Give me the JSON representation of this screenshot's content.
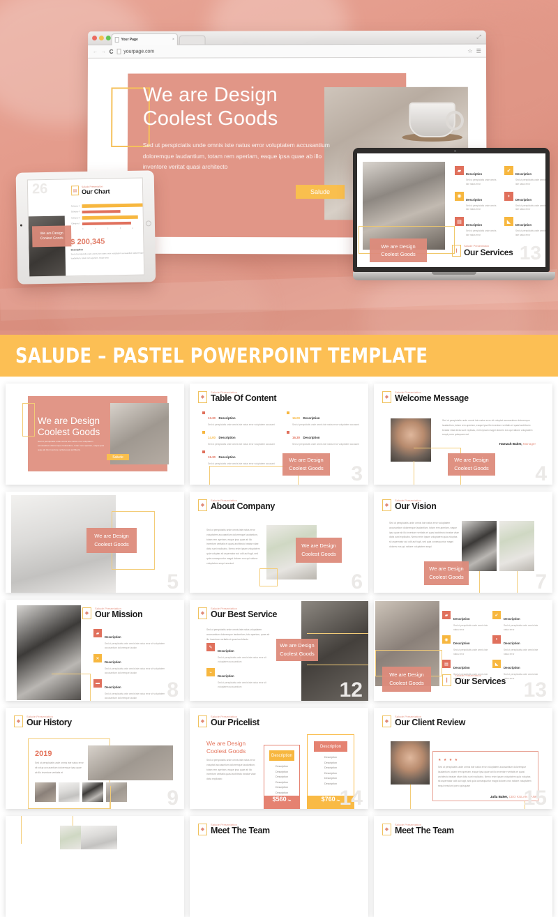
{
  "hero": {
    "browser": {
      "tab_title": "Your Page",
      "tab_close": "×",
      "url": "yourpage.com",
      "back_icon": "←",
      "forward_icon": "→",
      "reload_icon": "C",
      "star_icon": "☆",
      "menu_icon": "☰",
      "expand_icon": "⤢"
    },
    "slide": {
      "headline_line1": "We are Design",
      "headline_line2": "Coolest Goods",
      "body": "Sed ut perspiciatis unde omnis iste natus error voluptatem accusantium doloremque laudantium, totam rem aperiam, eaque ipsa quae ab illo inventore veritat quasi architecto",
      "button": "Salude"
    },
    "tablet": {
      "number": "26",
      "eyebrow": "Salude Presentation",
      "title": "Our Chart",
      "icon": "chart-icon",
      "badge_line1": "We are Design",
      "badge_line2": "Coolest Goods",
      "money": "$ 200,345",
      "desc_title": "Description",
      "desc_body": "Sed ut perspiciatis unde omnis iste natus error voluptatem accusantium doloremque laudantium, totam rem aperiam, eaque ipsa",
      "chart": {
        "categories": [
          "Category 4",
          "Category 3",
          "Category 2",
          "Category 1"
        ],
        "values": [
          4.5,
          2.8,
          4.1,
          3.6
        ],
        "colors": [
          "#f7b73f",
          "#e0705c",
          "#f7b73f",
          "#e0705c"
        ],
        "axis_ticks": [
          "0",
          "1",
          "2",
          "3",
          "4",
          "5"
        ]
      }
    },
    "laptop": {
      "number": "13",
      "eyebrow": "Salude Presentation",
      "title": "Our Services",
      "icon": "bookmark-icon",
      "badge_line1": "We are Design",
      "badge_line2": "Coolest Goods",
      "items": [
        {
          "icon": "image-icon",
          "glyph": "▰",
          "color": "#e0705c",
          "title": "Description",
          "body": "Sed ut perspiciatis unde omnis iste natus error"
        },
        {
          "icon": "check-icon",
          "glyph": "✔",
          "color": "#f7b73f",
          "title": "Description",
          "body": "Sed ut perspiciatis unde omnis iste natus error"
        },
        {
          "icon": "camera-icon",
          "glyph": "◉",
          "color": "#f7b73f",
          "title": "Description",
          "body": "Sed ut perspiciatis unde omnis iste natus error"
        },
        {
          "icon": "chat-icon",
          "glyph": "◗",
          "color": "#e0705c",
          "title": "Description",
          "body": "Sed ut perspiciatis unde omnis iste natus error"
        },
        {
          "icon": "database-icon",
          "glyph": "▤",
          "color": "#e0705c",
          "title": "Description",
          "body": "Sed ut perspiciatis unde omnis iste natus error"
        },
        {
          "icon": "tag-icon",
          "glyph": "◣",
          "color": "#f7b73f",
          "title": "Description",
          "body": "Sed ut perspiciatis unde omnis iste natus error"
        }
      ]
    }
  },
  "banner": {
    "title": "SALUDE – PASTEL POWERPOINT TEMPLATE"
  },
  "common": {
    "eyebrow": "Salude Presentation",
    "badge_line1": "We are Design",
    "badge_line2": "Coolest Goods",
    "description": "Description",
    "lorem_short": "Sed ut perspiciatis unde omnis iste natus error sit voluptatem accusantium doloremque laudan",
    "lorem_mid": "Sed ut perspiciatis unde omnis iste natus error voluptatem accusantium doloremque laudantium, totam rem aperiam, eaque ipsa quae ab illo inventore veritatis et quasi architecto beatae vitae dicta sunt explicabo.",
    "lorem_long": "Sed ut perspiciatis unde omnis iste natus error sit voluptatem accusantium doloremque laudantium, totam rem aperiam, eaque ipsa quae ab illo inventore veritatis et quasi architecto beatae vitae dicta sunt explicabo. Nemo enim ipsam voluptatem quia voluptas sit aspernatur aut odit aut fugit, sed quia consequuntur magni dolores eos qui ratione voluptatem sequi nesciunt"
  },
  "slides": [
    {
      "id": "cover",
      "name": "cover-slide",
      "number": "",
      "title": "",
      "headline_line1": "We are Design",
      "headline_line2": "Coolest Goods",
      "body": "Sed ut perspiciatis unde omnis iste natus error voluptatem accusantium doloremque laudantium, totam rem aperiam, eaque ipsa quae ab illo inventore veritat quasi architecto",
      "button": "Salude"
    },
    {
      "id": "toc",
      "name": "table-of-content-slide",
      "number": "3",
      "eyebrow": "Salude Presentation",
      "title": "Table Of Content",
      "icon": "pen-icon",
      "items": [
        {
          "time": "13.30",
          "color": "#e0705c",
          "title": "Description",
          "body": "Sed ut perspiciatis unde omnis iste natus error voluptatem accusant"
        },
        {
          "time": "16.00",
          "color": "#f7b73f",
          "title": "Description",
          "body": "Sed ut perspiciatis unde omnis iste natus error voluptatem accusant"
        },
        {
          "time": "14.00",
          "color": "#f7b73f",
          "title": "Description",
          "body": "Sed ut perspiciatis unde omnis iste natus error voluptatem accusant"
        },
        {
          "time": "16.30",
          "color": "#e0705c",
          "title": "Description",
          "body": "Sed ut perspiciatis unde omnis iste natus error voluptatem accusant"
        },
        {
          "time": "15.30",
          "color": "#e0705c",
          "title": "Description",
          "body": "Sed ut perspiciatis unde omnis iste natus error voluptatem accusant"
        }
      ]
    },
    {
      "id": "welcome",
      "name": "welcome-message-slide",
      "number": "4",
      "eyebrow": "Salude Presentation",
      "title": "Welcome Message",
      "icon": "rss-icon",
      "body": "Sed ut perspiciatis unde omnis iste natus error sit voluptat accusantium doloremque laudantium, totam rem aperiam, eaque ipsa illo inventore veritatis et quasi architecto beatae vitae dicta sunt explicau, enim ipsam magni dolores eos qui ratione voluptatem sequi porro quisquam est",
      "author_name": "Hamzah Baker,",
      "author_role": "Manager"
    },
    {
      "id": "office",
      "name": "office-photo-slide",
      "number": "5",
      "title": ""
    },
    {
      "id": "about",
      "name": "about-company-slide",
      "number": "6",
      "eyebrow": "Salude Presentation",
      "title": "About Company",
      "icon": "book-icon",
      "body": "Sed ut perspiciatis unde omnis iste natus error voluptatem accusantium doloremque laudantium, totam rem aperiam, eaque ipsa quae ab illo inventore veritatis et quasi architecto beatae vitae dicta sunt explicabo. Nemo enim ipsam voluptatem quia voluptas sit aspernatur aut odit aut fugit, sed quia consequuntur magni dolores eos qui ratione voluptatem sequi nesciunt"
    },
    {
      "id": "vision",
      "name": "our-vision-slide",
      "number": "7",
      "eyebrow": "Salude Presentation",
      "title": "Our Vision",
      "icon": "person-icon",
      "body": "Sed ut perspiciatis unde omnis iste natus error voluptatem accusantium doloremque laudantium, totam rem aperiam, eaque ipsa quae ab illo inventore veritatis et quasi architecto beatae vitae dicta sunt explicabo. Nemo enim ipsam voluptatem quia voluptas sit aspernatur aut odit aut fugit, sed quia consequuntur magni dolores eos qui ratione voluptatem sequi"
    },
    {
      "id": "mission",
      "name": "our-mission-slide",
      "number": "8",
      "eyebrow": "Salude Presentation",
      "title": "Our Mission",
      "icon": "rocket-icon",
      "items": [
        {
          "icon": "folder-icon",
          "glyph": "▰",
          "color": "#e0705c",
          "title": "Description",
          "body": "Sed ut perspiciatis unde omnis iste natus error sit voluptatem accusantium doloremque laudan"
        },
        {
          "icon": "tools-icon",
          "glyph": "✕",
          "color": "#f7b73f",
          "title": "Description",
          "body": "Sed ut perspiciatis unde omnis iste natus error sit voluptatem accusantium doloremque laudan"
        },
        {
          "icon": "briefcase-icon",
          "glyph": "▬",
          "color": "#e0705c",
          "title": "Description",
          "body": "Sed ut perspiciatis unde omnis iste natus error sit voluptatem accusantium doloremque laudan"
        }
      ]
    },
    {
      "id": "best-service",
      "name": "our-best-service-slide",
      "number": "12",
      "eyebrow": "Salude Presentation",
      "title": "Our Best Service",
      "icon": "pen-icon",
      "body": "Sed ut perspiciatis unde omnis iste natus voluptatem accusantium doloremque laudantium, tota aperiam, quae ab illo inventore veritatis et quasi architecto",
      "items": [
        {
          "icon": "pencil-icon",
          "glyph": "✎",
          "color": "#e0705c",
          "title": "Description",
          "body": "Sed ut perspiciatis unde omnis iste natus error sit voluptatem accusantium"
        },
        {
          "icon": "brush-icon",
          "glyph": "⌁",
          "color": "#f7b73f",
          "title": "Description",
          "body": "Sed ut perspiciatis unde omnis iste natus error sit voluptatem accusantium"
        }
      ]
    },
    {
      "id": "services",
      "name": "our-services-slide",
      "number": "13",
      "eyebrow": "Salude Presentation",
      "title": "Our Services",
      "icon": "bookmark-icon",
      "items": [
        {
          "icon": "image-icon",
          "glyph": "▰",
          "color": "#e0705c",
          "title": "Description",
          "body": "Sed ut perspiciatis unde omnis iste natus error"
        },
        {
          "icon": "check-icon",
          "glyph": "✔",
          "color": "#f7b73f",
          "title": "Description",
          "body": "Sed ut perspiciatis unde omnis iste natus error"
        },
        {
          "icon": "camera-icon",
          "glyph": "◉",
          "color": "#f7b73f",
          "title": "Description",
          "body": "Sed ut perspiciatis unde omnis iste natus error"
        },
        {
          "icon": "chat-icon",
          "glyph": "◗",
          "color": "#e0705c",
          "title": "Description",
          "body": "Sed ut perspiciatis unde omnis iste natus error"
        },
        {
          "icon": "database-icon",
          "glyph": "▤",
          "color": "#e0705c",
          "title": "Description",
          "body": "Sed ut perspiciatis unde omnis iste natus error"
        },
        {
          "icon": "tag-icon",
          "glyph": "◣",
          "color": "#f7b73f",
          "title": "Description",
          "body": "Sed ut perspiciatis unde omnis iste natus error"
        }
      ]
    },
    {
      "id": "history",
      "name": "our-history-slide",
      "number": "9",
      "eyebrow": "Salude Presentation",
      "title": "Our History",
      "icon": "pen-icon",
      "year": "2019",
      "body": "Sed ut perspiciatis unde omnis iste natus error sit volup accusantium doloremque ipsa quae ab illo inventore veritatis et"
    },
    {
      "id": "pricelist",
      "name": "our-pricelist-slide",
      "number": "14",
      "eyebrow": "Salude Presentation",
      "title": "Our Pricelist",
      "icon": "pen-icon",
      "headline_line1": "We are Design",
      "headline_line2": "Coolest Goods",
      "body": "Sed ut perspiciatis unde omnis iste natus error voluptati accusantium doloremque laudantium, totam rem aperiam, eaque ipsa quae ab illo inventore veritatis quasi architecto beatae vitae dicta explicabo",
      "plans": [
        {
          "header": "Description",
          "header_color": "#f7b73f",
          "price": "$560",
          "period": "/m",
          "price_color": "#e58271",
          "border_color": "#e58271",
          "features": [
            "Description",
            "Description",
            "Description",
            "Description",
            "Description",
            "Description",
            "Description"
          ]
        },
        {
          "header": "Description",
          "header_color": "#e58271",
          "price": "$760",
          "period": "/m",
          "price_color": "#f9ba45",
          "border_color": "#f9ba45",
          "features": [
            "Description",
            "Description",
            "Description",
            "Description",
            "Description",
            "Description"
          ]
        }
      ]
    },
    {
      "id": "client-review",
      "name": "our-client-review-slide",
      "number": "15",
      "eyebrow": "Salude Presentation",
      "title": "Our Client Review",
      "icon": "quote-icon",
      "stars": "★ ★ ★ ★",
      "body": "Sed ut perspiciatis unde omnis iste natus error voluptatem accusantium doloremque laudantium, totam rem aperiam, eaque ipsa quae ab illo inventore veritatis et quasi architecto beatae vitae dicta sunt explicabo. Nemo enim ipsam voluptatem quia voluptas sit aspernatur odit aut fugit, sed quia consequuntur magni dolores eos ratione voluptatem sequi nesciunt porro quisquam",
      "author_name": "Julia Baker,",
      "author_role": "CEO KULAN BANK"
    },
    {
      "id": "bottom-left",
      "name": "bottom-photo-slide",
      "number": "",
      "title": ""
    },
    {
      "id": "team-1",
      "name": "meet-the-team-slide-1",
      "number": "",
      "eyebrow": "Salude Presentation",
      "title": "Meet The Team",
      "icon": "person-icon"
    },
    {
      "id": "team-2",
      "name": "meet-the-team-slide-2",
      "number": "",
      "eyebrow": "Salude Presentation",
      "title": "Meet The Team",
      "icon": "person-icon"
    }
  ],
  "colors": {
    "coral": "#e0705c",
    "salmon": "#dd8b7b",
    "amber": "#f7b73f",
    "banner": "#fcbf54",
    "gold_border": "#f3cc77"
  }
}
